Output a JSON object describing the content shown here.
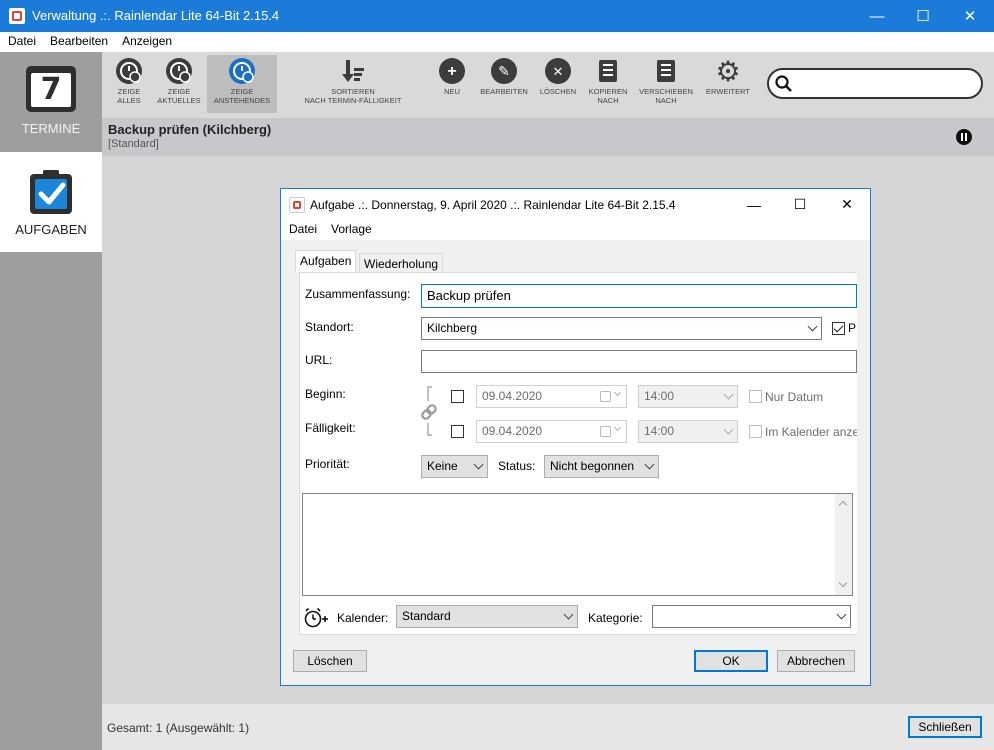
{
  "window": {
    "title": "Verwaltung .:. Rainlendar Lite 64-Bit 2.15.4",
    "controls": {
      "minimize": "—",
      "maximize": "☐",
      "close": "✕"
    }
  },
  "menu": [
    "Datei",
    "Bearbeiten",
    "Anzeigen"
  ],
  "sidebar": {
    "items": [
      {
        "label": "TERMINE",
        "icon": "calendar-7-icon",
        "icon_text": "7",
        "active": false
      },
      {
        "label": "AUFGABEN",
        "icon": "clipboard-check-icon",
        "active": true
      }
    ]
  },
  "toolbar": {
    "buttons": [
      {
        "label1": "ZEIGE",
        "label2": "ALLES",
        "icon": "clock-x-icon"
      },
      {
        "label1": "ZEIGE",
        "label2": "AKTUELLES",
        "icon": "clock-play-icon"
      },
      {
        "label1": "ZEIGE",
        "label2": "ANSTEHENDES",
        "icon": "clock-down-icon",
        "pressed": true
      },
      {
        "label1": "SORTIEREN",
        "label2": "NACH TERMIN-FÄLLIGKEIT",
        "icon": "sort-down-icon"
      },
      {
        "label1": "NEU",
        "label2": "",
        "icon": "plus-icon",
        "glyph": "+"
      },
      {
        "label1": "BEARBEITEN",
        "label2": "",
        "icon": "pencil-icon",
        "glyph": "✎"
      },
      {
        "label1": "LÖSCHEN",
        "label2": "",
        "icon": "x-circle-icon",
        "glyph": "✕"
      },
      {
        "label1": "KOPIEREN",
        "label2": "NACH",
        "icon": "copy-icon"
      },
      {
        "label1": "VERSCHIEBEN",
        "label2": "NACH",
        "icon": "move-icon"
      },
      {
        "label1": "ERWEITERT",
        "label2": "",
        "icon": "gear-refresh-icon",
        "glyph": "⚙"
      }
    ],
    "search_placeholder": ""
  },
  "task": {
    "title": "Backup prüfen (Kilchberg)",
    "subtitle": "[Standard]"
  },
  "status": {
    "text": "Gesamt: 1 (Ausgewählt: 1)",
    "close_button": "Schließen"
  },
  "dialog": {
    "title": "Aufgabe .:. Donnerstag, 9. April 2020 .:. Rainlendar Lite 64-Bit 2.15.4",
    "menu": [
      "Datei",
      "Vorlage"
    ],
    "tabs": [
      "Aufgaben",
      "Wiederholung"
    ],
    "labels": {
      "summary": "Zusammenfassung:",
      "location": "Standort:",
      "url": "URL:",
      "begin": "Beginn:",
      "due": "Fälligkeit:",
      "priority": "Priorität:",
      "status": "Status:",
      "calendar": "Kalender:",
      "category": "Kategorie:"
    },
    "values": {
      "summary": "Backup prüfen",
      "location": "Kilchberg",
      "location_check_label": "P",
      "url": "",
      "begin_date": "09.04.2020",
      "begin_time": "14:00",
      "due_date": "09.04.2020",
      "due_time": "14:00",
      "nur_datum": "Nur Datum",
      "im_kalender": "Im Kalender anze",
      "priority": "Keine",
      "status": "Nicht begonnen",
      "calendar": "Standard",
      "category": ""
    },
    "buttons": {
      "delete": "Löschen",
      "ok": "OK",
      "cancel": "Abbrechen"
    }
  }
}
